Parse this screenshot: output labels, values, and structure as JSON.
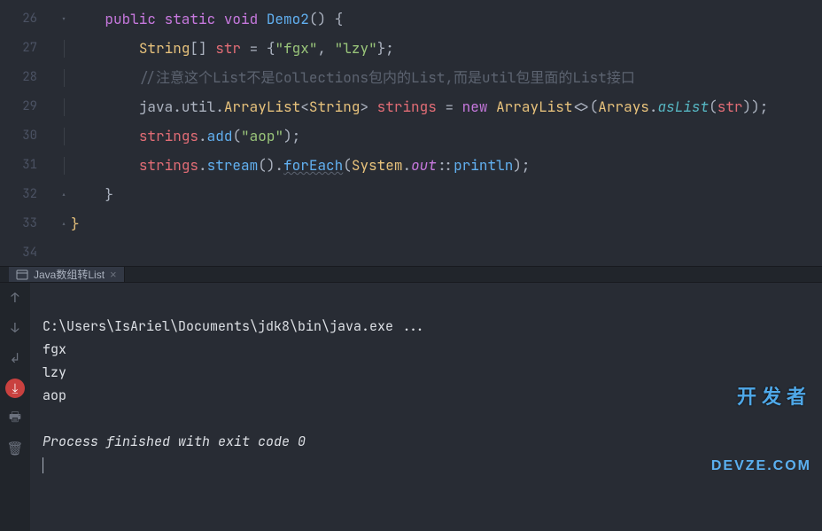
{
  "editor": {
    "lines": [
      {
        "num": "26",
        "fold": "chevron",
        "tokens": [
          {
            "t": "    ",
            "c": "pun"
          },
          {
            "t": "public ",
            "c": "kw"
          },
          {
            "t": "static ",
            "c": "kw"
          },
          {
            "t": "void ",
            "c": "kw"
          },
          {
            "t": "Demo2",
            "c": "mtd"
          },
          {
            "t": "() {",
            "c": "pun"
          }
        ]
      },
      {
        "num": "27",
        "fold": "bar",
        "tokens": [
          {
            "t": "        ",
            "c": "pun"
          },
          {
            "t": "String",
            "c": "cls"
          },
          {
            "t": "[] ",
            "c": "pun"
          },
          {
            "t": "str ",
            "c": "var"
          },
          {
            "t": "= {",
            "c": "pun"
          },
          {
            "t": "\"fgx\"",
            "c": "str"
          },
          {
            "t": ", ",
            "c": "pun"
          },
          {
            "t": "\"lzy\"",
            "c": "str"
          },
          {
            "t": "};",
            "c": "pun"
          }
        ]
      },
      {
        "num": "28",
        "fold": "bar",
        "tokens": [
          {
            "t": "        ",
            "c": "pun"
          },
          {
            "t": "//注意这个List不是Collections包内的List,而是util包里面的List接口",
            "c": "com"
          }
        ]
      },
      {
        "num": "29",
        "fold": "bar",
        "tokens": [
          {
            "t": "        ",
            "c": "pun"
          },
          {
            "t": "java.util.",
            "c": "pun"
          },
          {
            "t": "ArrayList",
            "c": "cls"
          },
          {
            "t": "<",
            "c": "pun"
          },
          {
            "t": "String",
            "c": "cls"
          },
          {
            "t": "> ",
            "c": "pun"
          },
          {
            "t": "strings ",
            "c": "var"
          },
          {
            "t": "= ",
            "c": "pun"
          },
          {
            "t": "new ",
            "c": "kw"
          },
          {
            "t": "ArrayList",
            "c": "cls"
          },
          {
            "t": "<>(",
            "c": "pun"
          },
          {
            "t": "Arrays",
            "c": "cls"
          },
          {
            "t": ".",
            "c": "pun"
          },
          {
            "t": "asList",
            "c": "mtd-i"
          },
          {
            "t": "(",
            "c": "pun"
          },
          {
            "t": "str",
            "c": "var"
          },
          {
            "t": "));",
            "c": "pun"
          }
        ]
      },
      {
        "num": "30",
        "fold": "bar",
        "tokens": [
          {
            "t": "        ",
            "c": "pun"
          },
          {
            "t": "strings",
            "c": "var"
          },
          {
            "t": ".",
            "c": "pun"
          },
          {
            "t": "add",
            "c": "mtd"
          },
          {
            "t": "(",
            "c": "pun"
          },
          {
            "t": "\"aop\"",
            "c": "str"
          },
          {
            "t": ");",
            "c": "pun"
          }
        ]
      },
      {
        "num": "31",
        "fold": "bar",
        "tokens": [
          {
            "t": "        ",
            "c": "pun"
          },
          {
            "t": "strings",
            "c": "var"
          },
          {
            "t": ".",
            "c": "pun"
          },
          {
            "t": "stream",
            "c": "mtd"
          },
          {
            "t": "().",
            "c": "pun"
          },
          {
            "t": "forEach",
            "c": "mtd underline"
          },
          {
            "t": "(",
            "c": "pun"
          },
          {
            "t": "System",
            "c": "cls"
          },
          {
            "t": ".",
            "c": "pun"
          },
          {
            "t": "out",
            "c": "field-i"
          },
          {
            "t": "::",
            "c": "pun"
          },
          {
            "t": "println",
            "c": "mtd"
          },
          {
            "t": ");",
            "c": "pun"
          }
        ]
      },
      {
        "num": "32",
        "fold": "chevron-up",
        "tokens": [
          {
            "t": "    }",
            "c": "pun"
          }
        ]
      },
      {
        "num": "33",
        "fold": "chevron-up",
        "tokens": [
          {
            "t": "}",
            "c": "cls"
          }
        ]
      },
      {
        "num": "34",
        "fold": "",
        "tokens": []
      }
    ]
  },
  "run_tab": {
    "label": "Java数组转List"
  },
  "console": {
    "cmd": "C:\\Users\\IsAriel\\Documents\\jdk8\\bin\\java.exe ...",
    "out1": "fgx",
    "out2": "lzy",
    "out3": "aop",
    "exit": "Process finished with exit code 0"
  },
  "watermark": {
    "cn": "开发者",
    "en": "DEVZE.COM"
  },
  "tool_icons": {
    "up": "↑",
    "down": "↓",
    "wrap": "↲",
    "download": "⤓",
    "print": "🖶",
    "trash": "🗑"
  }
}
